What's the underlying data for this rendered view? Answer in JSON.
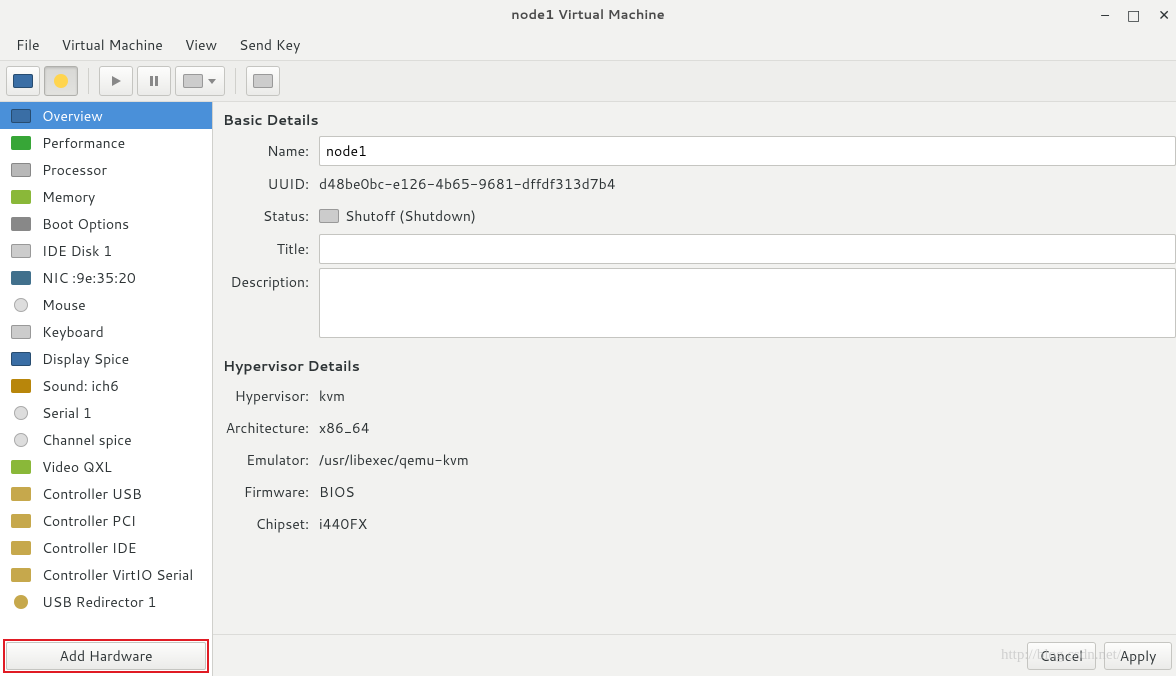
{
  "titlebar": {
    "title": "node1 Virtual Machine"
  },
  "menubar": {
    "items": [
      "File",
      "Virtual Machine",
      "View",
      "Send Key"
    ]
  },
  "sidebar": {
    "items": [
      {
        "label": "Overview",
        "icon": "sq-mon",
        "selected": true
      },
      {
        "label": "Performance",
        "icon": "sq-perf"
      },
      {
        "label": "Processor",
        "icon": "sq-cpu"
      },
      {
        "label": "Memory",
        "icon": "sq-mem"
      },
      {
        "label": "Boot Options",
        "icon": "sq-boot"
      },
      {
        "label": "IDE Disk 1",
        "icon": "sq-disk"
      },
      {
        "label": "NIC :9e:35:20",
        "icon": "sq-nic"
      },
      {
        "label": "Mouse",
        "icon": "sq-mouse"
      },
      {
        "label": "Keyboard",
        "icon": "sq-kbd"
      },
      {
        "label": "Display Spice",
        "icon": "sq-mon"
      },
      {
        "label": "Sound: ich6",
        "icon": "sq-snd"
      },
      {
        "label": "Serial 1",
        "icon": "sq-ser"
      },
      {
        "label": "Channel spice",
        "icon": "sq-ser"
      },
      {
        "label": "Video QXL",
        "icon": "sq-vid"
      },
      {
        "label": "Controller USB",
        "icon": "sq-ctrl"
      },
      {
        "label": "Controller PCI",
        "icon": "sq-ctrl"
      },
      {
        "label": "Controller IDE",
        "icon": "sq-ctrl"
      },
      {
        "label": "Controller VirtIO Serial",
        "icon": "sq-ctrl"
      },
      {
        "label": "USB Redirector 1",
        "icon": "sq-usb"
      }
    ],
    "add_hardware": "Add Hardware"
  },
  "basic": {
    "section": "Basic Details",
    "name_label": "Name:",
    "name_value": "node1",
    "uuid_label": "UUID:",
    "uuid_value": "d48be0bc-e126-4b65-9681-dffdf313d7b4",
    "status_label": "Status:",
    "status_value": "Shutoff (Shutdown)",
    "title_label": "Title:",
    "title_value": "",
    "desc_label": "Description:",
    "desc_value": ""
  },
  "hyper": {
    "section": "Hypervisor Details",
    "hv_label": "Hypervisor:",
    "hv_value": "kvm",
    "arch_label": "Architecture:",
    "arch_value": "x86_64",
    "emu_label": "Emulator:",
    "emu_value": "/usr/libexec/qemu-kvm",
    "fw_label": "Firmware:",
    "fw_value": "BIOS",
    "chip_label": "Chipset:",
    "chip_value": "i440FX"
  },
  "footer": {
    "cancel": "Cancel",
    "apply": "Apply"
  },
  "watermark": "http://blog.csdn.net/…"
}
